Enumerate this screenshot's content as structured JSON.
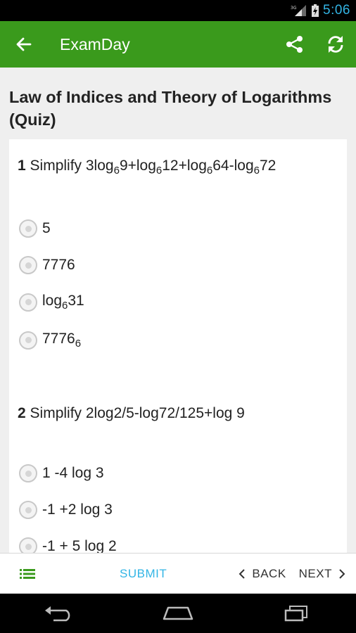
{
  "status": {
    "time": "5:06",
    "network": "3G"
  },
  "appbar": {
    "title": "ExamDay"
  },
  "quiz": {
    "title": "Law of Indices and Theory of Logarithms (Quiz)"
  },
  "questions": [
    {
      "number": "1",
      "text_parts": [
        "Simplify 3log",
        "6",
        "9+log",
        "6",
        "12+log",
        "6",
        "64-log",
        "6",
        "72"
      ],
      "options": [
        {
          "text": "5"
        },
        {
          "text": "7776"
        },
        {
          "base": "log",
          "sub": "6",
          "tail": "31"
        },
        {
          "base": "7776",
          "sub": "6"
        }
      ]
    },
    {
      "number": "2",
      "text": "Simplify 2log2/5-log72/125+log 9",
      "options": [
        {
          "text": "1 -4 log 3"
        },
        {
          "text": "-1 +2 log 3"
        },
        {
          "text": "-1 + 5 log 2"
        }
      ]
    }
  ],
  "bottom": {
    "submit": "SUBMIT",
    "back": "BACK",
    "next": "NEXT"
  }
}
